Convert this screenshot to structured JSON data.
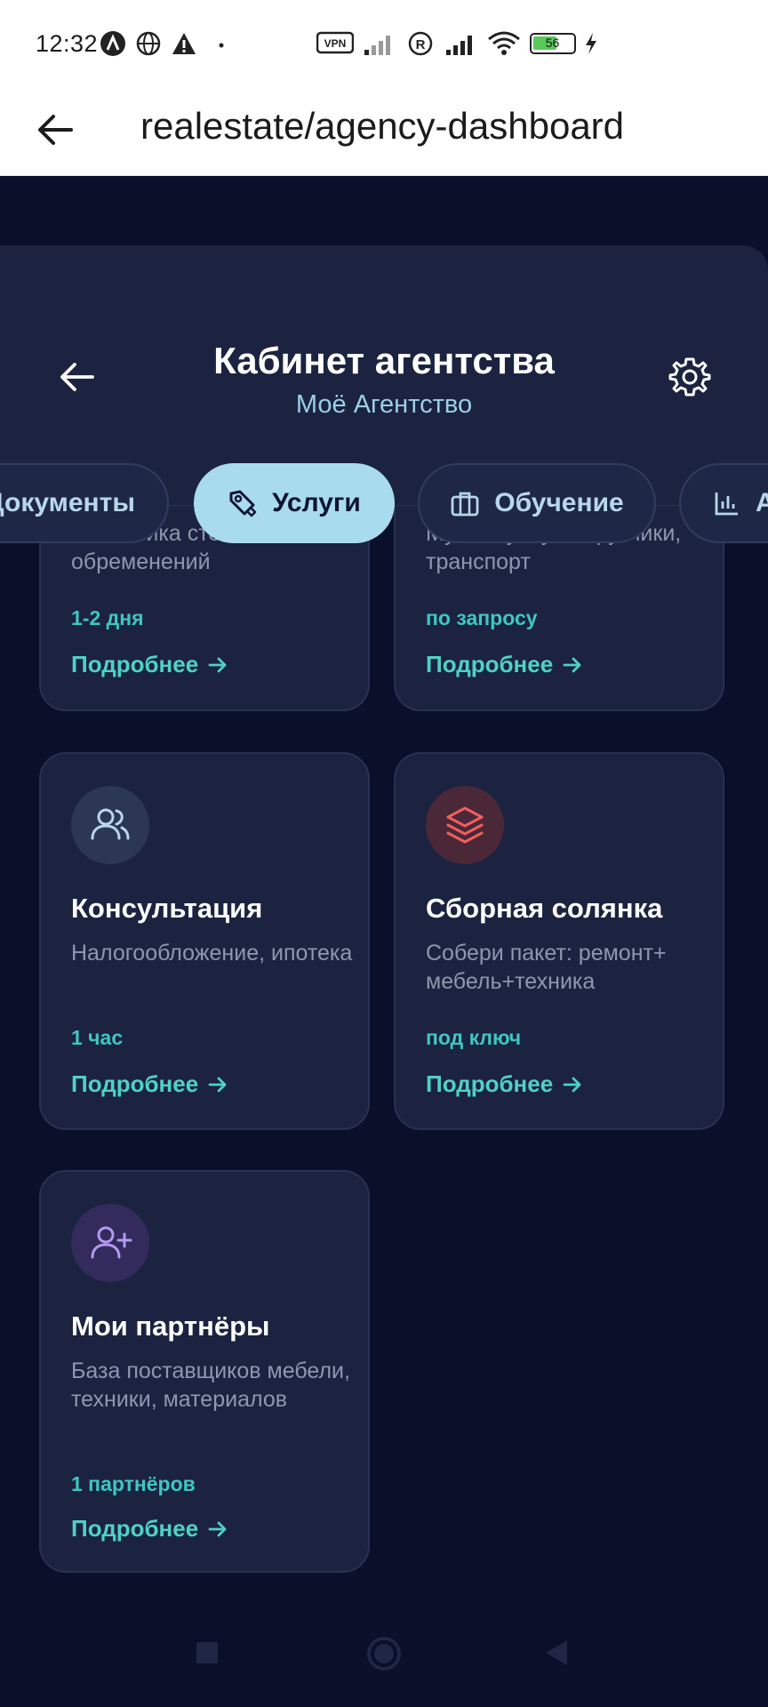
{
  "status_bar": {
    "time": "12:32",
    "battery": "56"
  },
  "browser": {
    "url": "realestate/agency-dashboard"
  },
  "header": {
    "title": "Кабинет агентства",
    "subtitle": "Моё Агентство"
  },
  "tabs": [
    {
      "label": "Документы",
      "icon": "documents-icon",
      "active": false
    },
    {
      "label": "Услуги",
      "icon": "pen-tool-icon",
      "active": true
    },
    {
      "label": "Обучение",
      "icon": "briefcase-icon",
      "active": false
    },
    {
      "label": "А",
      "icon": "bar-chart-icon",
      "active": false
    }
  ],
  "cards": [
    {
      "title": "",
      "description": "Аналитика стоимости и обременений",
      "meta": "1-2 дня",
      "more": "Подробнее"
    },
    {
      "title": "",
      "description": "Мувинг услуги. Грузчики, транспорт",
      "meta": "по запросу",
      "more": "Подробнее"
    },
    {
      "title": "Консультация",
      "description": "Налогообложение, ипотека",
      "meta": "1 час",
      "more": "Подробнее",
      "icon": "users-icon"
    },
    {
      "title": "Сборная солянка",
      "description": "Собери пакет: ремонт+ мебель+техника",
      "meta": "под ключ",
      "more": "Подробнее",
      "icon": "layers-icon"
    },
    {
      "title": "Мои партнёры",
      "description": "База поставщиков мебели, техники, материалов",
      "meta": "1 партнёров",
      "more": "Подробнее",
      "icon": "user-plus-icon"
    }
  ],
  "colors": {
    "background": "#0a0f2a",
    "card": "#1b2340",
    "accent": "#4fd1c5",
    "active_tab": "#a9dbef"
  }
}
